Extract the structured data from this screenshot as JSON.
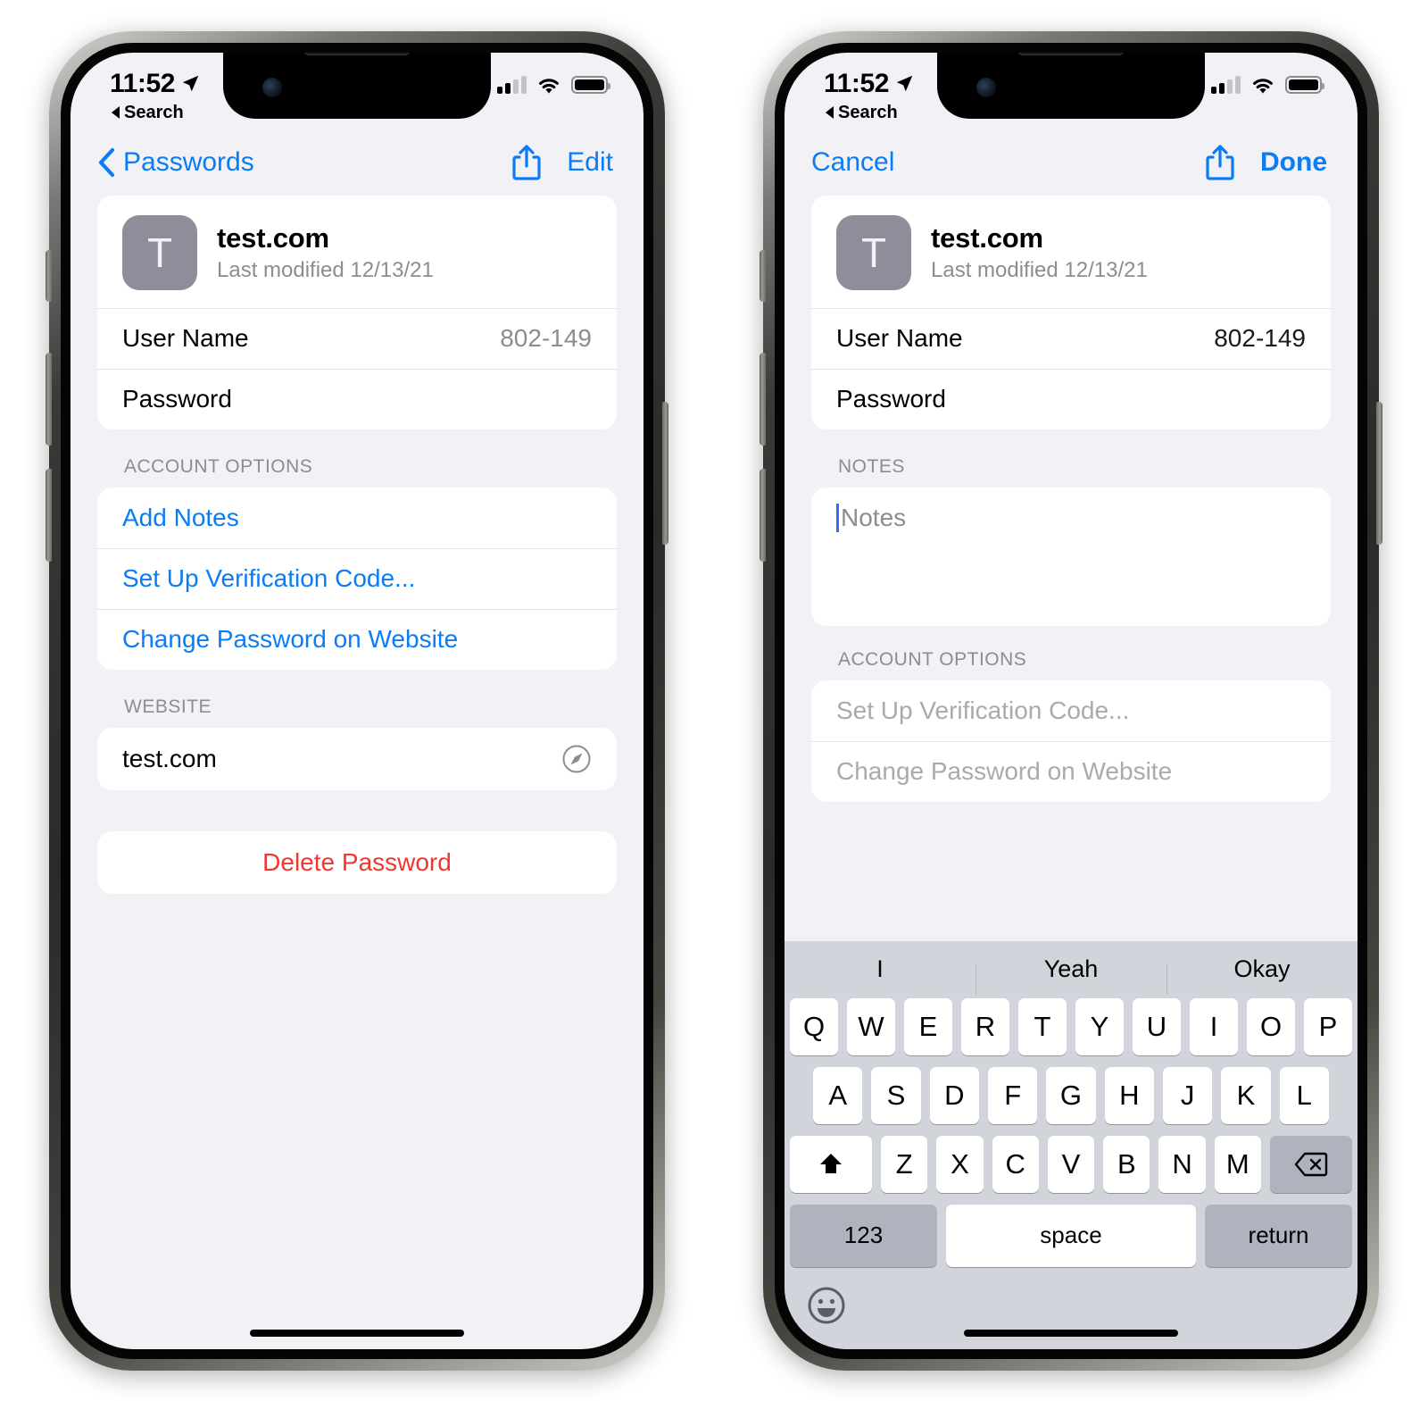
{
  "status_bar": {
    "time": "11:52",
    "back_label": "Search",
    "location_icon": "location-arrow-icon",
    "signal_icon": "cellular-signal-icon",
    "signal_bars_filled": 2,
    "signal_bars_total": 4,
    "wifi_icon": "wifi-icon",
    "battery_icon": "battery-full-icon"
  },
  "colors": {
    "accent_blue": "#0a7cf6",
    "destructive_red": "#f1372f",
    "secondary_gray": "#8c8c92",
    "disabled_gray": "#a9a9b0",
    "page_background": "#f1f1f6",
    "card_background": "#ffffff",
    "keyboard_background": "#d1d4da",
    "icon_tile": "#8e8e9b",
    "caret_blue": "#2f6df5"
  },
  "left_phone": {
    "nav": {
      "back_label": "Passwords",
      "back_icon": "chevron-left-icon",
      "share_icon": "share-icon",
      "edit_label": "Edit"
    },
    "detail_card": {
      "icon_letter": "T",
      "title": "test.com",
      "subtitle": "Last modified 12/13/21",
      "rows": [
        {
          "label": "User Name",
          "value": "802-149"
        },
        {
          "label": "Password",
          "value": ""
        }
      ]
    },
    "account_options": {
      "section_label": "ACCOUNT OPTIONS",
      "items": [
        {
          "label": "Add Notes"
        },
        {
          "label": "Set Up Verification Code..."
        },
        {
          "label": "Change Password on Website"
        }
      ]
    },
    "website": {
      "section_label": "WEBSITE",
      "value": "test.com",
      "icon": "safari-compass-icon"
    },
    "delete_label": "Delete Password"
  },
  "right_phone": {
    "nav": {
      "cancel_label": "Cancel",
      "share_icon": "share-icon",
      "done_label": "Done"
    },
    "detail_card": {
      "icon_letter": "T",
      "title": "test.com",
      "subtitle": "Last modified 12/13/21",
      "rows": [
        {
          "label": "User Name",
          "value": "802-149"
        },
        {
          "label": "Password",
          "value": ""
        }
      ]
    },
    "notes": {
      "section_label": "NOTES",
      "placeholder": "Notes",
      "value": ""
    },
    "account_options": {
      "section_label": "ACCOUNT OPTIONS",
      "items": [
        {
          "label": "Set Up Verification Code..."
        },
        {
          "label": "Change Password on Website"
        }
      ]
    },
    "keyboard": {
      "predictions": [
        "I",
        "Yeah",
        "Okay"
      ],
      "row1": [
        "Q",
        "W",
        "E",
        "R",
        "T",
        "Y",
        "U",
        "I",
        "O",
        "P"
      ],
      "row2": [
        "A",
        "S",
        "D",
        "F",
        "G",
        "H",
        "J",
        "K",
        "L"
      ],
      "row3": [
        "Z",
        "X",
        "C",
        "V",
        "B",
        "N",
        "M"
      ],
      "shift_icon": "shift-up-arrow-icon",
      "backspace_icon": "backspace-delete-icon",
      "numbers_label": "123",
      "space_label": "space",
      "return_label": "return",
      "emoji_icon": "emoji-smiley-icon"
    }
  }
}
